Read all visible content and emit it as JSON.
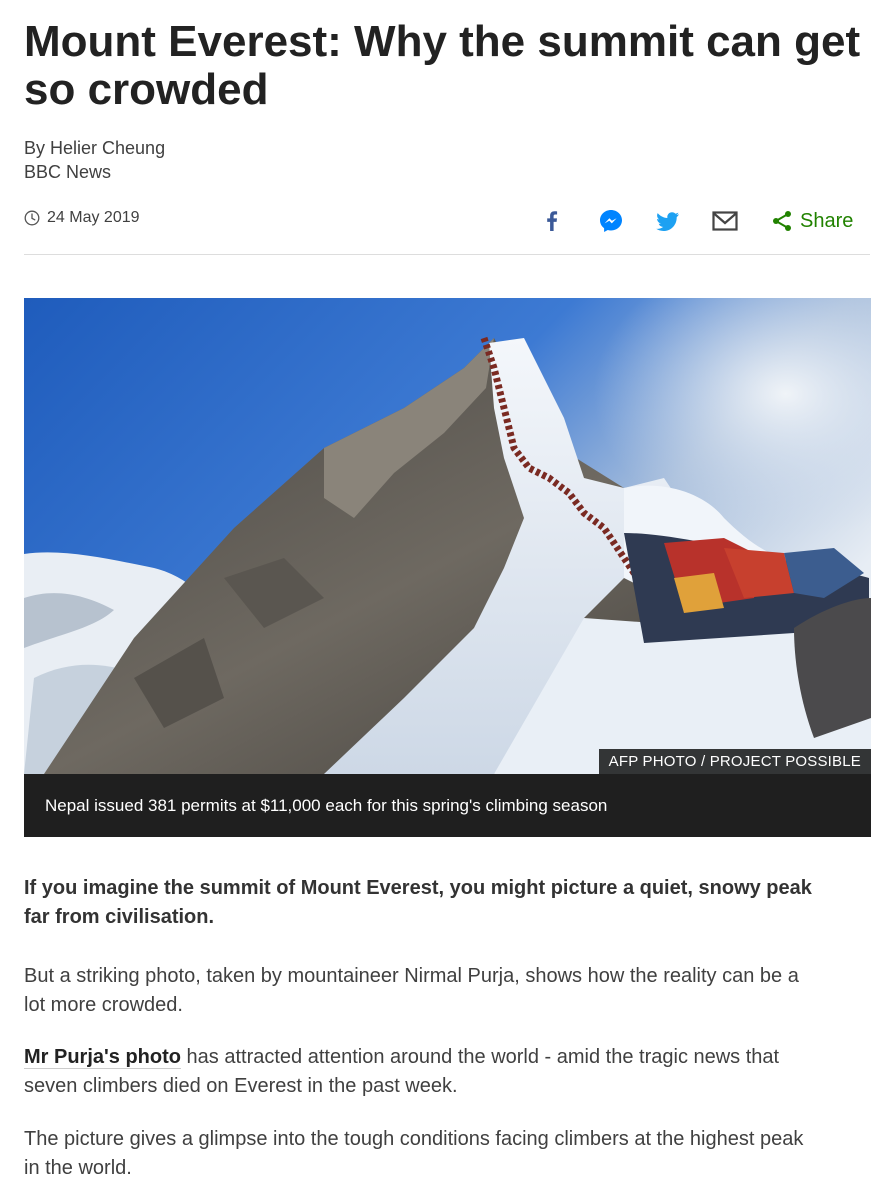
{
  "article": {
    "title": "Mount Everest: Why the summit can get so crowded",
    "author": "By Helier Cheung",
    "outlet": "BBC News",
    "date": "24 May 2019"
  },
  "share": {
    "label": "Share",
    "icons": [
      "facebook-icon",
      "messenger-icon",
      "twitter-icon",
      "email-icon",
      "share-icon"
    ]
  },
  "image": {
    "credit": "AFP PHOTO / PROJECT POSSIBLE",
    "caption": "Nepal issued 381 permits at $11,000 each for this spring's climbing season"
  },
  "body": {
    "lead": "If you imagine the summit of Mount Everest, you might picture a quiet, snowy peak far from civilisation.",
    "p2": "But a striking photo, taken by mountaineer Nirmal Purja, shows how the reality can be a lot more crowded.",
    "p3_link": "Mr Purja's photo",
    "p3_rest": " has attracted attention around the world - amid the tragic news that seven climbers died on Everest in the past week.",
    "p4": "The picture gives a glimpse into the tough conditions facing climbers at the highest peak in the world."
  },
  "colors": {
    "share_green": "#218200",
    "facebook_blue": "#3b5998",
    "messenger_blue": "#0084ff",
    "twitter_blue": "#1da1f2",
    "caption_bg": "#1f1f1f"
  }
}
